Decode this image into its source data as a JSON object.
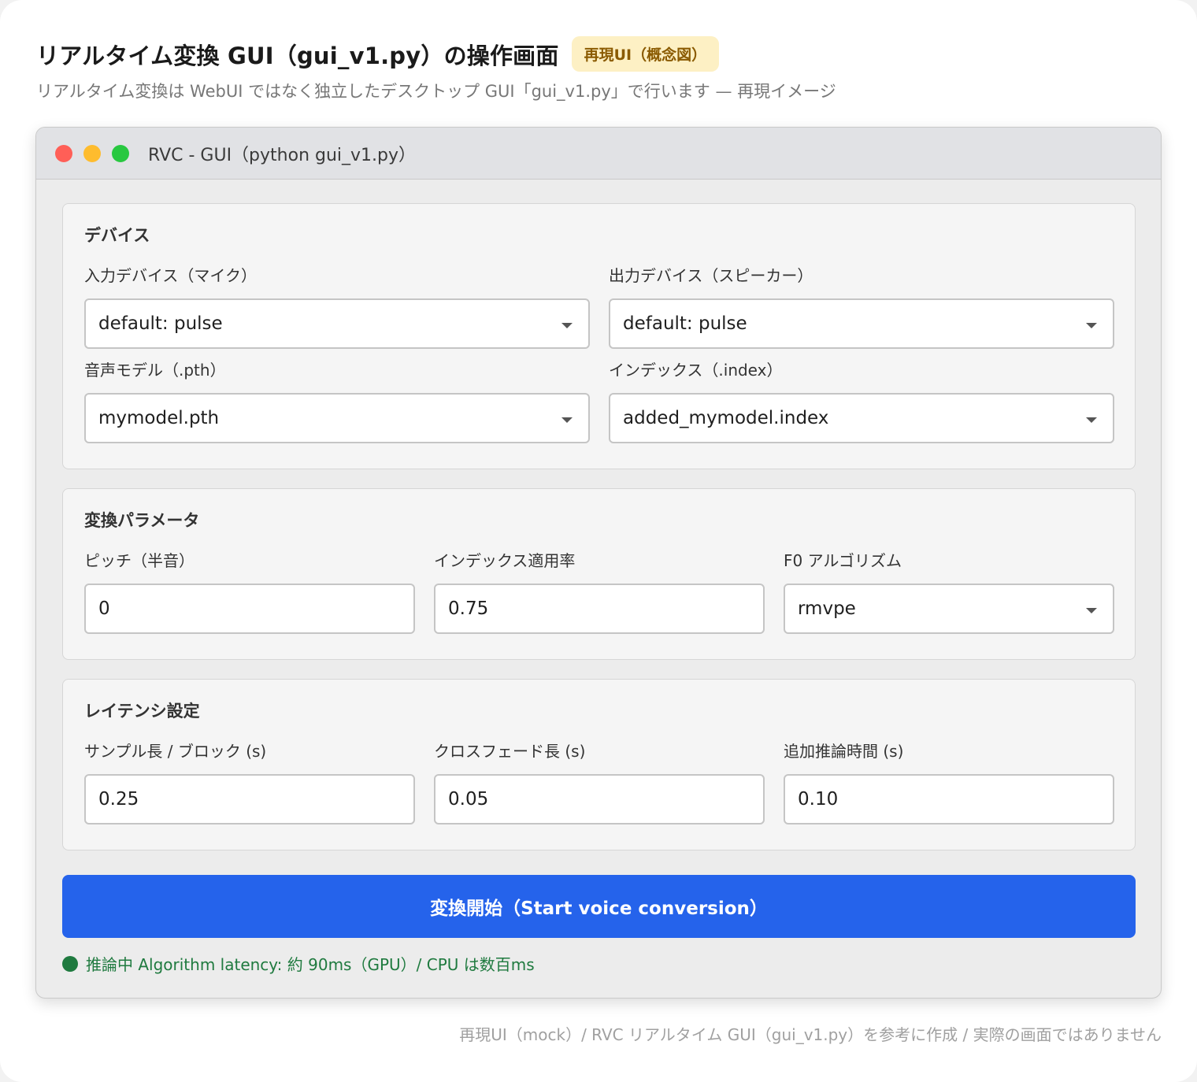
{
  "page": {
    "title": "リアルタイム変換 GUI（gui_v1.py）の操作画面",
    "badge": "再現UI（概念図）",
    "subtitle": "リアルタイム変換は WebUI ではなく独立したデスクトップ GUI「gui_v1.py」で行います — 再現イメージ",
    "footer": "再現UI（mock）/ RVC リアルタイム GUI（gui_v1.py）を参考に作成 / 実際の画面ではありません"
  },
  "window": {
    "title": "RVC - GUI（python gui_v1.py）"
  },
  "devices": {
    "title": "デバイス",
    "input_label": "入力デバイス（マイク）",
    "input_value": "default: pulse",
    "output_label": "出力デバイス（スピーカー）",
    "output_value": "default: pulse",
    "model_label": "音声モデル（.pth）",
    "model_value": "mymodel.pth",
    "index_label": "インデックス（.index）",
    "index_value": "added_mymodel.index"
  },
  "params": {
    "title": "変換パラメータ",
    "pitch_label": "ピッチ（半音）",
    "pitch_value": "0",
    "index_rate_label": "インデックス適用率",
    "index_rate_value": "0.75",
    "f0_label": "F0 アルゴリズム",
    "f0_value": "rmvpe"
  },
  "latency": {
    "title": "レイテンシ設定",
    "block_label": "サンプル長 / ブロック (s)",
    "block_value": "0.25",
    "crossfade_label": "クロスフェード長 (s)",
    "crossfade_value": "0.05",
    "extra_label": "追加推論時間 (s)",
    "extra_value": "0.10"
  },
  "start_button": "変換開始（Start voice conversion）",
  "status": "推論中 Algorithm latency: 約 90ms（GPU）/ CPU は数百ms",
  "colors": {
    "accent": "#2563eb",
    "status": "#1f7a3f",
    "badge_bg": "#fdf0c4",
    "badge_text": "#8a5a00"
  }
}
